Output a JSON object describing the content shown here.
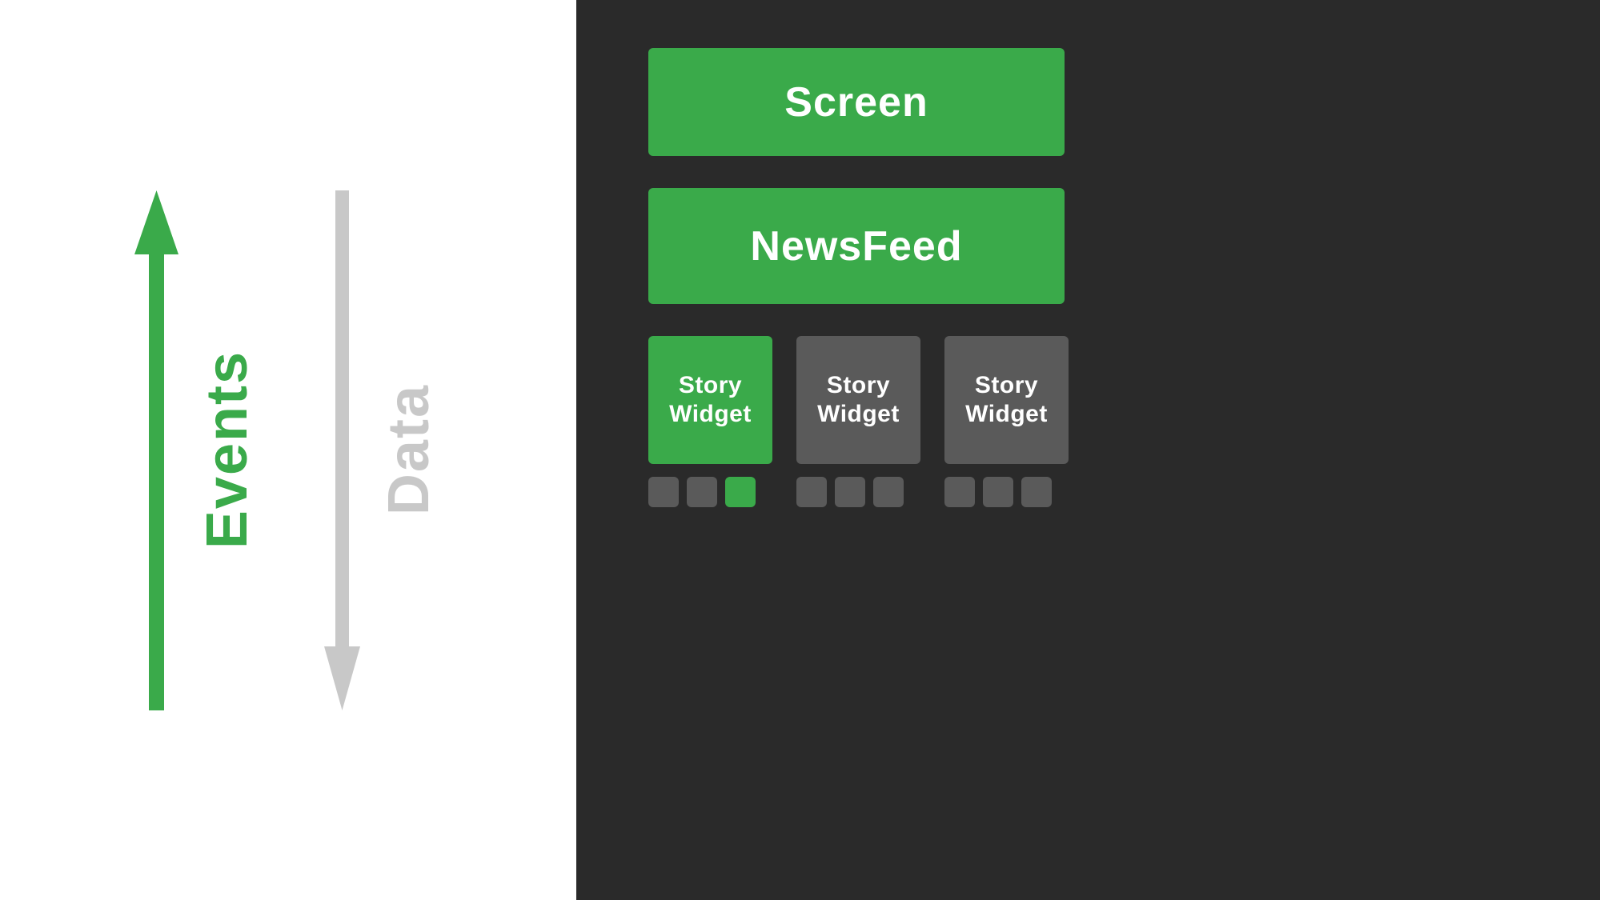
{
  "left_panel": {
    "events_label": "Events",
    "data_label": "Data",
    "arrow_up_color": "#3aaa4a",
    "arrow_down_color": "#c8c8c8"
  },
  "right_panel": {
    "background_color": "#2a2a2a",
    "screen_block": {
      "label": "Screen",
      "bg_color": "#3aaa4a"
    },
    "newsfeed_block": {
      "label": "NewsFeed",
      "bg_color": "#3aaa4a"
    },
    "story_widgets": [
      {
        "label": "Story Widget",
        "color": "green",
        "indicators": [
          "gray",
          "gray",
          "green"
        ]
      },
      {
        "label": "Story Widget",
        "color": "gray",
        "indicators": [
          "gray",
          "gray",
          "gray"
        ]
      },
      {
        "label": "Story Widget",
        "color": "gray",
        "indicators": [
          "gray",
          "gray",
          "gray"
        ]
      }
    ]
  }
}
